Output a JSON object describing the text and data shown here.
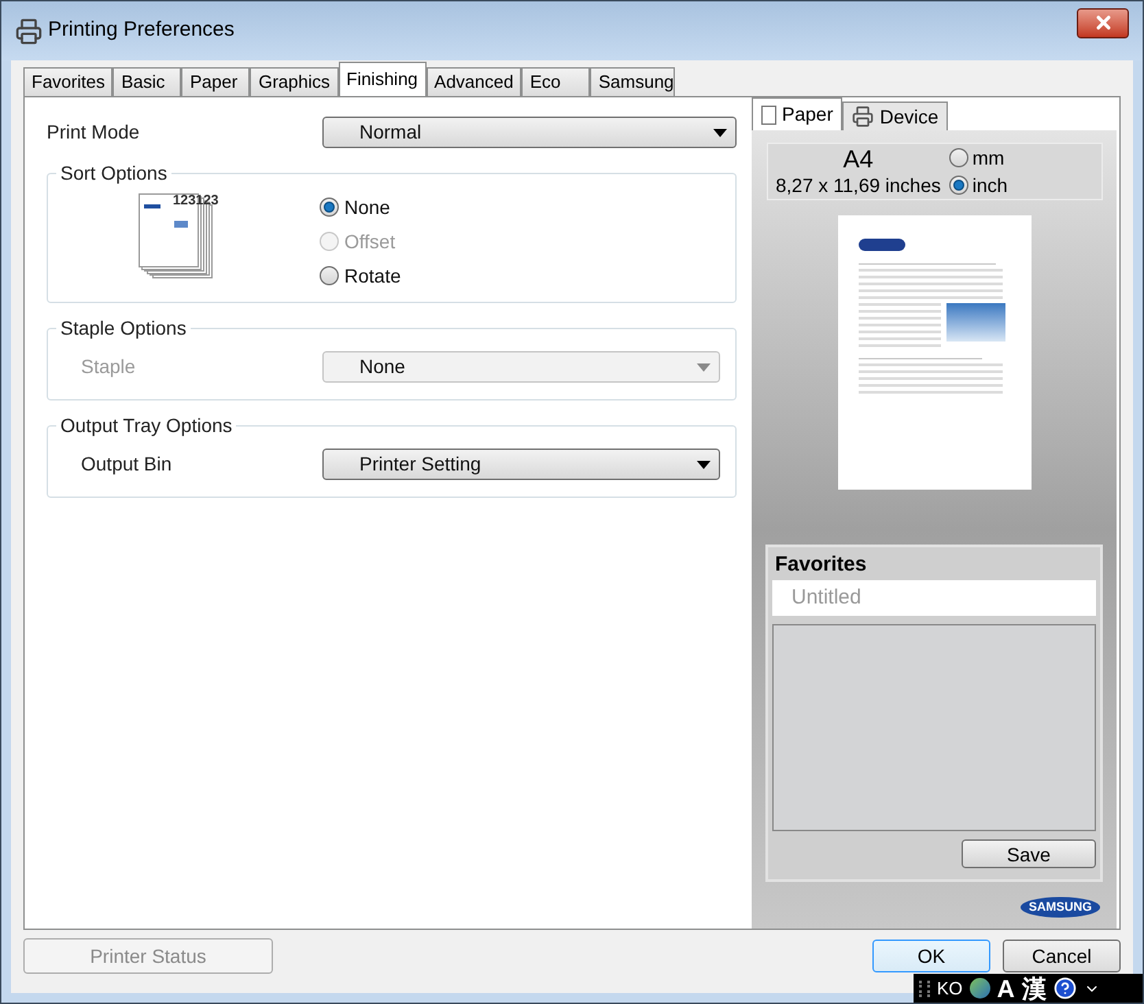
{
  "window": {
    "title": "Printing Preferences"
  },
  "tabs": [
    {
      "label": "Favorites",
      "selected": false
    },
    {
      "label": "Basic",
      "selected": false
    },
    {
      "label": "Paper",
      "selected": false
    },
    {
      "label": "Graphics",
      "selected": false
    },
    {
      "label": "Finishing",
      "selected": true
    },
    {
      "label": "Advanced",
      "selected": false
    },
    {
      "label": "Eco",
      "selected": false
    },
    {
      "label": "Samsung",
      "selected": false
    }
  ],
  "print_mode": {
    "label": "Print Mode",
    "value": "Normal"
  },
  "sort_options": {
    "title": "Sort Options",
    "icon_text": "123123",
    "options": [
      {
        "label": "None",
        "selected": true,
        "disabled": false
      },
      {
        "label": "Offset",
        "selected": false,
        "disabled": true
      },
      {
        "label": "Rotate",
        "selected": false,
        "disabled": false
      }
    ]
  },
  "staple_options": {
    "title": "Staple Options",
    "label": "Staple",
    "value": "None",
    "disabled": true
  },
  "output_tray_options": {
    "title": "Output Tray Options",
    "label": "Output Bin",
    "value": "Printer Setting"
  },
  "preview_tabs": [
    {
      "label": "Paper",
      "selected": true
    },
    {
      "label": "Device",
      "selected": false
    }
  ],
  "paper": {
    "size": "A4",
    "dimensions": "8,27 x 11,69 inches",
    "units": [
      {
        "label": "mm",
        "selected": false
      },
      {
        "label": "inch",
        "selected": true
      }
    ]
  },
  "favorites": {
    "title": "Favorites",
    "placeholder": "Untitled",
    "save": "Save"
  },
  "logo": "SAMSUNG",
  "buttons": {
    "printer_status": {
      "label": "Printer Status",
      "disabled": true
    },
    "ok": "OK",
    "cancel": "Cancel"
  },
  "language_bar": {
    "language": "KO",
    "items": [
      "A",
      "漢"
    ]
  }
}
